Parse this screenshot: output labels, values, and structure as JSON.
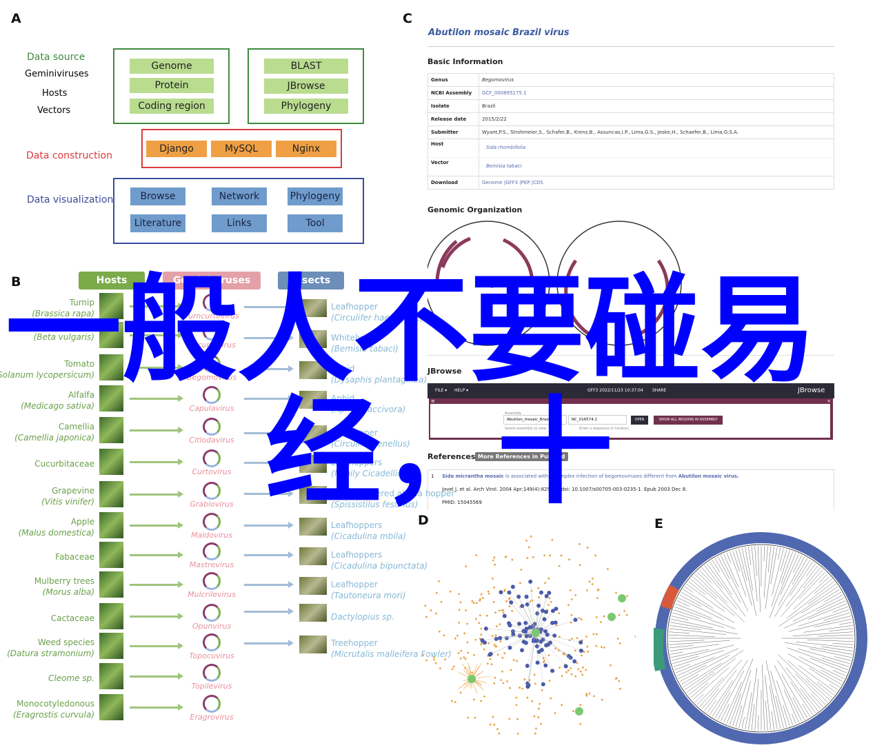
{
  "panels": {
    "a": "A",
    "b": "B",
    "c": "C",
    "d": "D",
    "e": "E"
  },
  "panel_a": {
    "data_source": {
      "title": "Data source",
      "items": [
        "Geminiviruses",
        "Hosts",
        "Vectors"
      ],
      "box1": [
        "Genome",
        "Protein",
        "Coding region"
      ],
      "box2": [
        "BLAST",
        "JBrowse",
        "Phylogeny"
      ]
    },
    "data_construction": {
      "title": "Data construction",
      "items": [
        "Django",
        "MySQL",
        "Nginx"
      ]
    },
    "data_visualization": {
      "title": "Data visualization",
      "items": [
        "Browse",
        "Network",
        "Phylogeny",
        "Literature",
        "Links",
        "Tool"
      ]
    }
  },
  "panel_b": {
    "headers": {
      "hosts": "Hosts",
      "viruses": "Geminiviruses",
      "insects": "Insects"
    },
    "hosts": [
      {
        "name": "Turnip",
        "sci": "(Brassica rapa)"
      },
      {
        "name": "",
        "sci": "(Beta vulgaris)"
      },
      {
        "name": "Tomato",
        "sci": "(Solanum lycopersicum)"
      },
      {
        "name": "Alfalfa",
        "sci": "(Medicago sativa)"
      },
      {
        "name": "Camellia",
        "sci": "(Camellia japonica)"
      },
      {
        "name": "Cucurbitaceae",
        "sci": ""
      },
      {
        "name": "Grapevine",
        "sci": "(Vitis vinifer)"
      },
      {
        "name": "Apple",
        "sci": "(Malus domestica)"
      },
      {
        "name": "Fabaceae",
        "sci": ""
      },
      {
        "name": "Mulberry trees",
        "sci": "(Morus alba)"
      },
      {
        "name": "Cactaceae",
        "sci": ""
      },
      {
        "name": "Weed species",
        "sci": "(Datura stramonium)"
      },
      {
        "name": "",
        "sci": "Cleome sp."
      },
      {
        "name": "Monocotyledonous",
        "sci": "(Eragrostis curvula)"
      }
    ],
    "viruses": [
      "Turncurtovirus",
      "Becurtovirus",
      "Begomovirus",
      "Capulavirus",
      "Citlodavirus",
      "Curtovirus",
      "Grablovirus",
      "Maldovirus",
      "Mastrevirus",
      "Mulcrilevirus",
      "Opunvirus",
      "Topocuvirus",
      "Topilevirus",
      "Eragrovirus"
    ],
    "insects": [
      {
        "name": "Leafhopper",
        "sci": "(Circulifer haematoceps)"
      },
      {
        "name": "Whitely",
        "sci": "(Bemisia tabaci)"
      },
      {
        "name": "Aphid",
        "sci": "(Dysaphis plantaginea)"
      },
      {
        "name": "Aphid",
        "sci": "(Aphis craccivora)"
      },
      {
        "name": "Leafhopper",
        "sci": "(Circulifer tenellus)"
      },
      {
        "name": "Leafhoppers",
        "sci": "(family Cicadellidae)"
      },
      {
        "name": "Three-cornered alfalfa hopper",
        "sci": "(Spissistilus festinus)"
      },
      {
        "name": "Leafhoppers",
        "sci": "(Cicadulina mbila)"
      },
      {
        "name": "Leafhoppers",
        "sci": "(Cicadulina bipunctata)"
      },
      {
        "name": "Leafhopper",
        "sci": "(Tautoneura mori)"
      },
      {
        "name": "",
        "sci": "Dactylopius sp."
      },
      {
        "name": "Treehopper",
        "sci": "(Micrutalis malleifera Fowler)"
      }
    ]
  },
  "panel_c": {
    "title": "Abutilon mosaic Brazil virus",
    "basic_info": "Basic Information",
    "rows": [
      {
        "k": "Genus",
        "v": "Begomovirus"
      },
      {
        "k": "NCBI Assembly",
        "v": "GCF_000895175.1"
      },
      {
        "k": "Isolate",
        "v": "Brazil"
      },
      {
        "k": "Release date",
        "v": "2015/2/22"
      },
      {
        "k": "Submitter",
        "v": "Wyant,P.S., Strohmeier,S., Schafer,B., Krenz,B., Assuncao,I.P., Lima,G.S., Jeske,H., Schaefer,B., Lima,G.S.A."
      },
      {
        "k": "Host",
        "v": "Sida rhombifolia"
      },
      {
        "k": "Vector",
        "v": "Bemisia tabaci"
      },
      {
        "k": "Download",
        "v": "Genome |GFF3 |PEP |CDS"
      }
    ],
    "genomic_org": "Genomic Organization",
    "plasmid_label": "NC_01657",
    "jbrowse_heading": "JBrowse",
    "jbrowse": {
      "file": "FILE ▾",
      "help": "HELP ▾",
      "session": "GFF3 2022/11/23 10:37:04",
      "share": "SHARE",
      "brand": "JBrowse",
      "assembly_label": "Assembly",
      "assembly": "Abutilon_mosaic_Brazil_virus",
      "assembly_help": "Select assembly to view",
      "locus": "NC_016574.1",
      "locus_help": "Enter a sequence or location",
      "open": "OPEN",
      "show_all": "SHOW ALL REGIONS IN ASSEMBLY"
    },
    "references": "References",
    "pubmed_btn": "More References in PubMed",
    "ref": {
      "num": "1",
      "title_a": "Sida micrantha mosaic",
      "title_b": " is associated with a complex infection of begomoviruses different from ",
      "title_c": "Abutilon mosaic virus.",
      "cite": "Jovel J, et al. Arch Virol. 2004 Apr;149(4):829-41. doi: 10.1007/s00705-003-0235-1. Epub 2003 Dec 8.",
      "pmid": "PMID: 15045569"
    }
  },
  "colors": {
    "network_node": "#4a5aa8",
    "network_leaf": "#e8a040",
    "network_hub": "#7cc870",
    "tree_ring": "#5068b0",
    "overlay": "#0000ff"
  },
  "overlay": {
    "line1": "一般人不要碰易",
    "line2": "经，十"
  }
}
